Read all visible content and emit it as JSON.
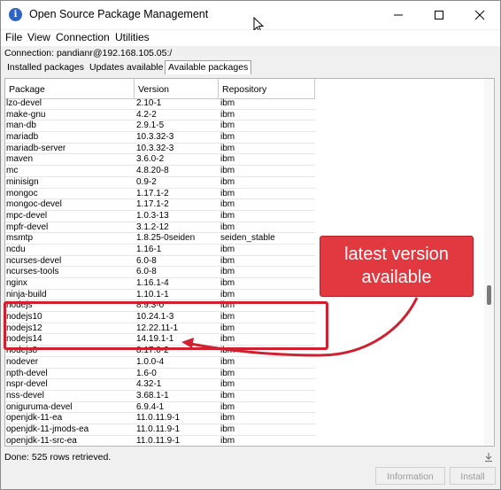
{
  "window": {
    "title": "Open Source Package Management",
    "icon": "app-logo-icon"
  },
  "menu": [
    "File",
    "View",
    "Connection",
    "Utilities"
  ],
  "connection_label": "Connection: pandianr@192.168.105.05:/",
  "tabs": [
    "Installed packages",
    "Updates available",
    "Available packages"
  ],
  "active_tab": "Available packages",
  "table": {
    "columns": [
      "Package",
      "Version",
      "Repository"
    ],
    "rows": [
      [
        "lzo-devel",
        "2.10-1",
        "ibm"
      ],
      [
        "make-gnu",
        "4.2-2",
        "ibm"
      ],
      [
        "man-db",
        "2.9.1-5",
        "ibm"
      ],
      [
        "mariadb",
        "10.3.32-3",
        "ibm"
      ],
      [
        "mariadb-server",
        "10.3.32-3",
        "ibm"
      ],
      [
        "maven",
        "3.6.0-2",
        "ibm"
      ],
      [
        "mc",
        "4.8.20-8",
        "ibm"
      ],
      [
        "minisign",
        "0.9-2",
        "ibm"
      ],
      [
        "mongoc",
        "1.17.1-2",
        "ibm"
      ],
      [
        "mongoc-devel",
        "1.17.1-2",
        "ibm"
      ],
      [
        "mpc-devel",
        "1.0.3-13",
        "ibm"
      ],
      [
        "mpfr-devel",
        "3.1.2-12",
        "ibm"
      ],
      [
        "msmtp",
        "1.8.25-0seiden",
        "seiden_stable"
      ],
      [
        "ncdu",
        "1.16-1",
        "ibm"
      ],
      [
        "ncurses-devel",
        "6.0-8",
        "ibm"
      ],
      [
        "ncurses-tools",
        "6.0-8",
        "ibm"
      ],
      [
        "nginx",
        "1.16.1-4",
        "ibm"
      ],
      [
        "ninja-build",
        "1.10.1-1",
        "ibm"
      ],
      [
        "nodejs",
        "8.9.3-0",
        "ibm"
      ],
      [
        "nodejs10",
        "10.24.1-3",
        "ibm"
      ],
      [
        "nodejs12",
        "12.22.11-1",
        "ibm"
      ],
      [
        "nodejs14",
        "14.19.1-1",
        "ibm"
      ],
      [
        "nodejs8",
        "8.17.0-2",
        "ibm"
      ],
      [
        "nodever",
        "1.0.0-4",
        "ibm"
      ],
      [
        "npth-devel",
        "1.6-0",
        "ibm"
      ],
      [
        "nspr-devel",
        "4.32-1",
        "ibm"
      ],
      [
        "nss-devel",
        "3.68.1-1",
        "ibm"
      ],
      [
        "oniguruma-devel",
        "6.9.4-1",
        "ibm"
      ],
      [
        "openjdk-11-ea",
        "11.0.11.9-1",
        "ibm"
      ],
      [
        "openjdk-11-jmods-ea",
        "11.0.11.9-1",
        "ibm"
      ],
      [
        "openjdk-11-src-ea",
        "11.0.11.9-1",
        "ibm"
      ]
    ]
  },
  "annotation": {
    "line1": "latest version",
    "line2": "available",
    "color": "#e2383f"
  },
  "status": "Done: 525 rows retrieved.",
  "buttons": {
    "information": "Information",
    "install": "Install"
  }
}
